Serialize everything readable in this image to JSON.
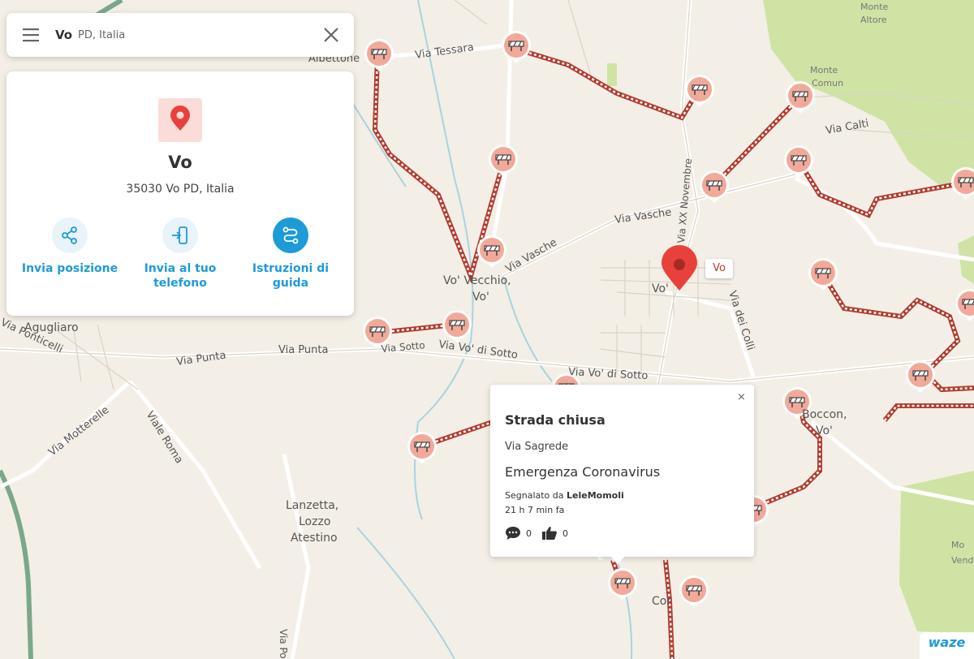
{
  "search": {
    "query": "Vo",
    "context": "PD, Italia"
  },
  "place": {
    "name": "Vo",
    "address": "35030 Vo PD, Italia",
    "actions": [
      {
        "label_line1": "Invia posizione",
        "label_line2": "",
        "icon": "share-icon"
      },
      {
        "label_line1": "Invia al tuo",
        "label_line2": "telefono",
        "icon": "send-to-phone-icon"
      },
      {
        "label_line1": "Istruzioni di",
        "label_line2": "guida",
        "icon": "route-icon"
      }
    ]
  },
  "alert": {
    "title": "Strada chiusa",
    "street": "Via Sagrede",
    "description": "Emergenza Coronavirus",
    "reported_by_prefix": "Segnalato da ",
    "reported_by_user": "LeleMomoli",
    "time_ago": "21 h 7 min fa",
    "comments": "0",
    "thumbs": "0",
    "close_glyph": "×"
  },
  "map": {
    "pin_tag": "Vo",
    "brand": "waze",
    "colors": {
      "closure": "#c0392b",
      "pin": "#e8413c",
      "accent": "#1d9bd8",
      "forest": "#cfe3a5"
    },
    "labels": [
      {
        "text": "Via Tessara"
      },
      {
        "text": "Albettone"
      },
      {
        "text": "Via Vasche"
      },
      {
        "text": "Via Vasche"
      },
      {
        "text": "Vo' Vecchio,"
      },
      {
        "text": "Vo'"
      },
      {
        "text": "Vo'"
      },
      {
        "text": "Via dei Colli"
      },
      {
        "text": "Via Punta"
      },
      {
        "text": "Via Punta"
      },
      {
        "text": "Via Vo' di Sotto"
      },
      {
        "text": "Via Vo' di Sotto"
      },
      {
        "text": "Agugliaro"
      },
      {
        "text": "Via Ponticelli"
      },
      {
        "text": "Via Motterelle"
      },
      {
        "text": "Viale Roma"
      },
      {
        "text": "Lanzetta,"
      },
      {
        "text": "Lozzo"
      },
      {
        "text": "Atestino"
      },
      {
        "text": "Boccon,"
      },
      {
        "text": "Vo'"
      },
      {
        "text": "Monte"
      },
      {
        "text": "Altore"
      },
      {
        "text": "Monte"
      },
      {
        "text": "Comun"
      },
      {
        "text": "Via Calti"
      },
      {
        "text": "Via Sotto"
      },
      {
        "text": "Cor"
      },
      {
        "text": "Mo"
      },
      {
        "text": "Vend"
      },
      {
        "text": "Via Po"
      },
      {
        "text": "Via XX Novembre"
      }
    ]
  }
}
